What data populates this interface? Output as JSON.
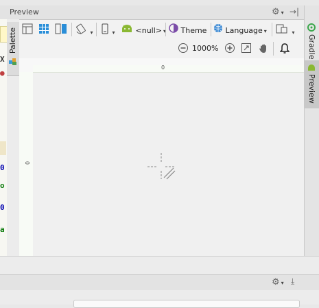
{
  "header": {
    "title": "Preview"
  },
  "palette": {
    "tab_label": "Palette"
  },
  "toolbar": {
    "device_label": "<null>",
    "theme_label": "Theme",
    "language_label": "Language"
  },
  "zoom": {
    "level": "1000%"
  },
  "rulers": {
    "top_origin": "0",
    "left_origin": "0"
  },
  "right_sidebar": {
    "tabs": [
      {
        "label": "Gradle"
      },
      {
        "label": "Preview"
      }
    ]
  },
  "editor_fragments": [
    "X",
    "0",
    "o",
    "0",
    "a"
  ],
  "colors": {
    "accent": "#2a8ed8",
    "android_green": "#8ab833",
    "theme_purple": "#7b4ca8",
    "language_blue": "#2a7fd0"
  }
}
